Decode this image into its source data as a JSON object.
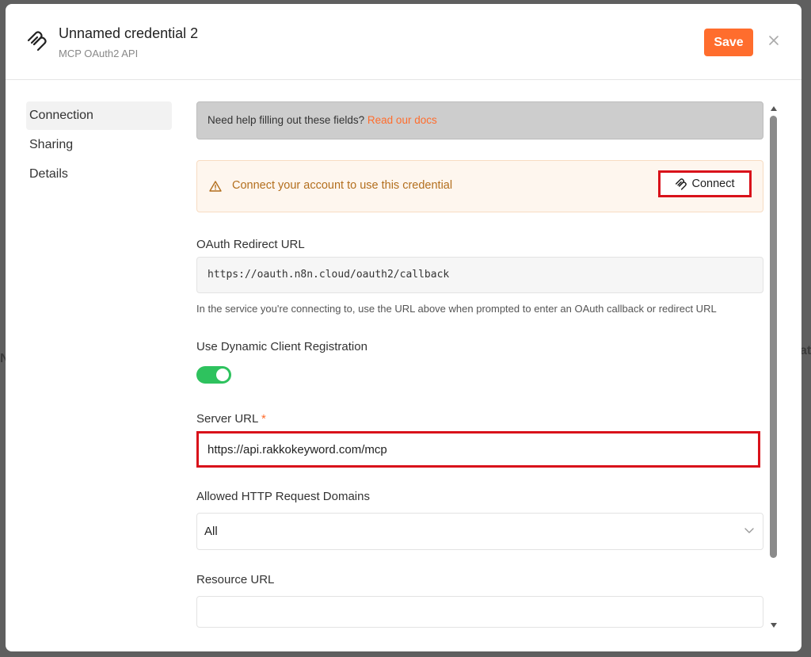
{
  "background": {
    "peek_left": "N",
    "peek_right": "ata"
  },
  "header": {
    "title": "Unnamed credential 2",
    "subtitle": "MCP OAuth2 API",
    "save_label": "Save",
    "close_icon": "close-icon"
  },
  "sidebar": {
    "items": [
      {
        "label": "Connection",
        "active": true
      },
      {
        "label": "Sharing",
        "active": false
      },
      {
        "label": "Details",
        "active": false
      }
    ]
  },
  "help": {
    "text": "Need help filling out these fields?",
    "link": "Read our docs"
  },
  "connect_banner": {
    "text": "Connect your account to use this credential",
    "button_label": "Connect"
  },
  "fields": {
    "redirect_label": "OAuth Redirect URL",
    "redirect_value": "https://oauth.n8n.cloud/oauth2/callback",
    "redirect_hint": "In the service you're connecting to, use the URL above when prompted to enter an OAuth callback or redirect URL",
    "dcr_label": "Use Dynamic Client Registration",
    "dcr_enabled": true,
    "server_label": "Server URL",
    "server_required": "*",
    "server_value": "https://api.rakkokeyword.com/mcp",
    "domains_label": "Allowed HTTP Request Domains",
    "domains_value": "All",
    "resource_label": "Resource URL",
    "resource_value": ""
  },
  "colors": {
    "accent": "#ff6d2d",
    "toggle_on": "#2ec25e",
    "highlight": "#d9121b",
    "warning_text": "#b36f1e"
  }
}
